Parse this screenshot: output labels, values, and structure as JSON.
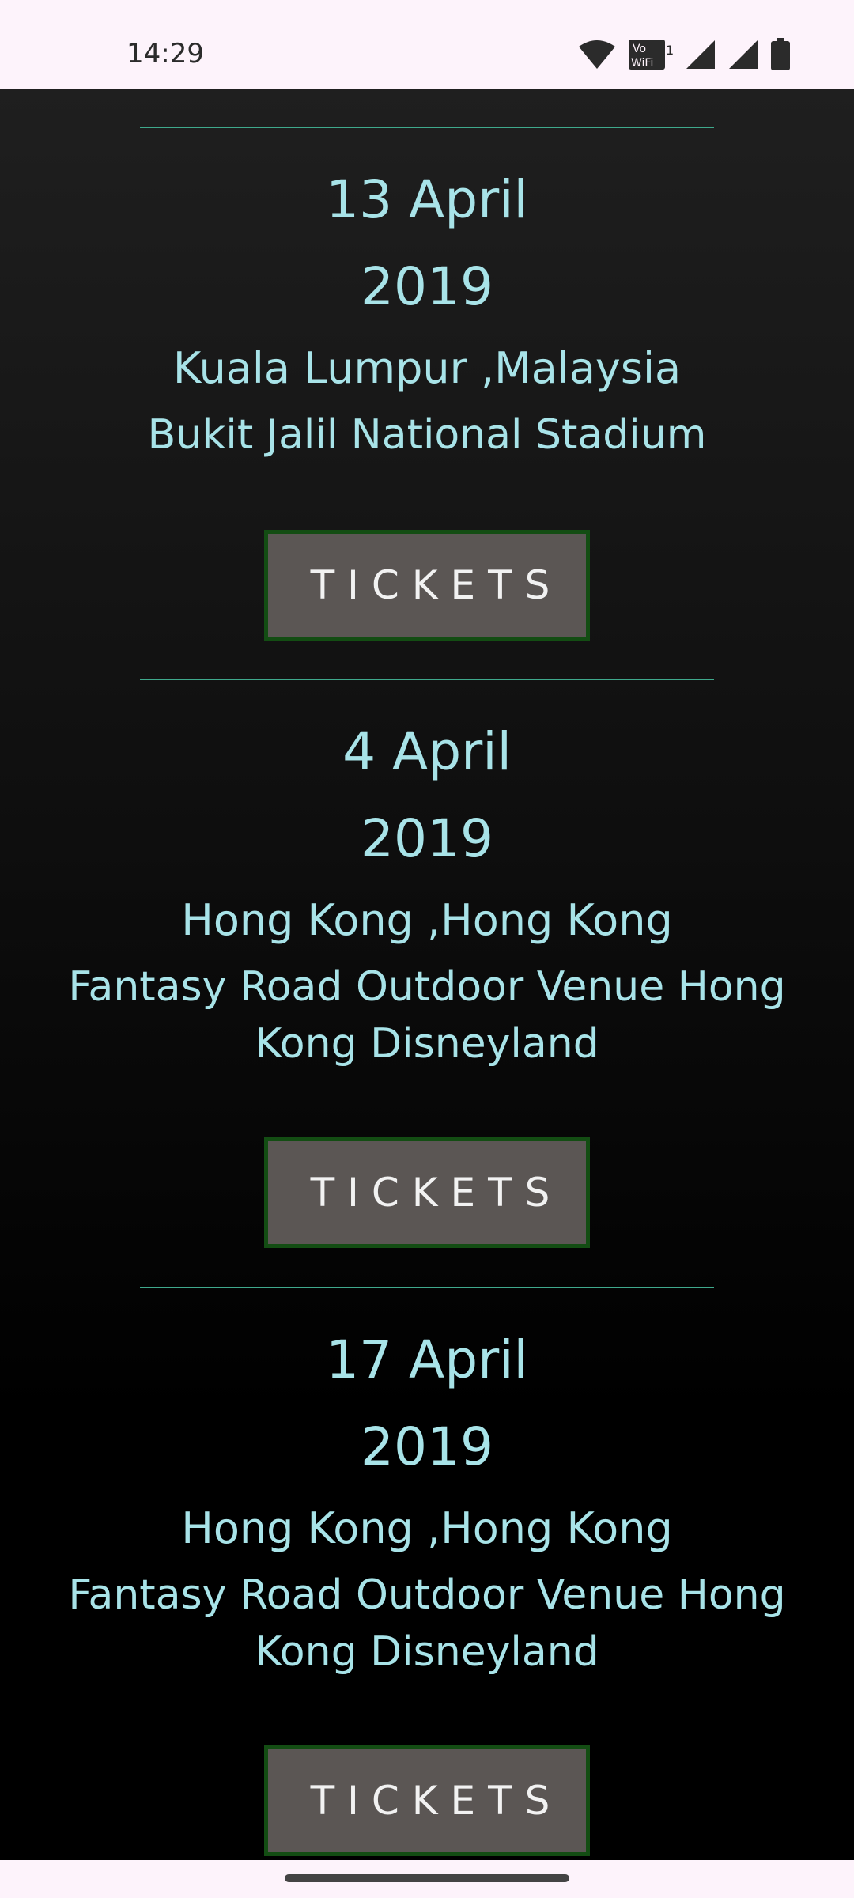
{
  "status_bar": {
    "time": "14:29",
    "icons": [
      "wifi-icon",
      "vowifi-icon",
      "signal-icon",
      "signal-icon",
      "battery-icon"
    ],
    "vowifi_label_top": "Vo",
    "vowifi_label_bottom": "WiFi",
    "vowifi_sim": "1"
  },
  "events": [
    {
      "date_line1": "13 April",
      "date_line2": "2019",
      "location": "Kuala Lumpur ,Malaysia",
      "venue": "Bukit Jalil National Stadium",
      "button_label": "TICKETS"
    },
    {
      "date_line1": "4 April",
      "date_line2": "2019",
      "location": "Hong Kong ,Hong Kong",
      "venue": "Fantasy Road Outdoor Venue Hong Kong Disneyland",
      "button_label": "TICKETS"
    },
    {
      "date_line1": "17 April",
      "date_line2": "2019",
      "location": "Hong Kong ,Hong Kong",
      "venue": "Fantasy Road Outdoor Venue Hong Kong Disneyland",
      "button_label": "TICKETS"
    }
  ],
  "colors": {
    "text_accent": "#a8e3e8",
    "divider": "#3fa98c",
    "button_bg": "#5b5654",
    "button_border": "#134d13"
  }
}
